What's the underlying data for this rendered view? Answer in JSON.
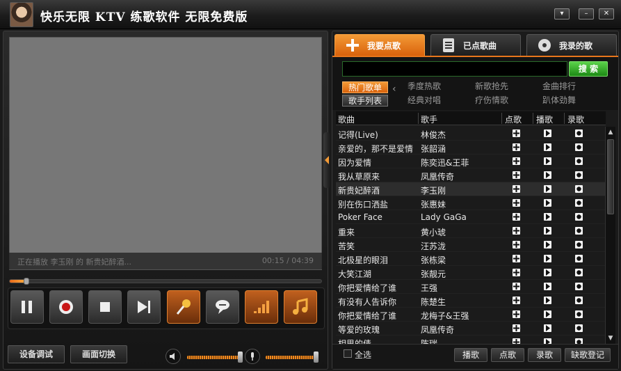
{
  "window": {
    "title": "快乐无限 KTV 练歌软件  无限免费版"
  },
  "player": {
    "now_playing": "正在播放 李玉刚 的 新贵妃醉酒...",
    "time": "00:15 / 04:39",
    "progress": 0.054
  },
  "bottom": {
    "device_btn": "设备调试",
    "screen_btn": "画面切换",
    "music_volume": 0.95,
    "mic_volume": 0.95
  },
  "tabs": [
    {
      "label": "我要点歌",
      "active": true
    },
    {
      "label": "已点歌曲",
      "active": false
    },
    {
      "label": "我录的歌",
      "active": false
    }
  ],
  "search": {
    "value": "",
    "button": "搜 索"
  },
  "categories": {
    "hot": "热门歌单",
    "artists": "歌手列表",
    "links": [
      "季度热歌",
      "新歌抢先",
      "金曲排行",
      "经典对唱",
      "疗伤情歌",
      "趴体劲舞"
    ]
  },
  "table": {
    "headers": [
      "歌曲",
      "歌手",
      "点歌",
      "播歌",
      "录歌"
    ],
    "rows": [
      {
        "song": "记得(Live)",
        "artist": "林俊杰"
      },
      {
        "song": "亲爱的，那不是爱情",
        "artist": "张韶涵"
      },
      {
        "song": "因为爱情",
        "artist": "陈奕迅&王菲"
      },
      {
        "song": "我从草原来",
        "artist": "凤凰传奇"
      },
      {
        "song": "新贵妃醉酒",
        "artist": "李玉刚",
        "highlight": true
      },
      {
        "song": "别在伤口洒盐",
        "artist": "张惠妹"
      },
      {
        "song": "Poker Face",
        "artist": "Lady GaGa"
      },
      {
        "song": "重来",
        "artist": "黄小琥"
      },
      {
        "song": "苦笑",
        "artist": "汪苏泷"
      },
      {
        "song": "北极星的眼泪",
        "artist": "张栋梁"
      },
      {
        "song": "大笑江湖",
        "artist": "张靓元"
      },
      {
        "song": "你把爱情给了谁",
        "artist": "王强"
      },
      {
        "song": "有没有人告诉你",
        "artist": "陈楚生"
      },
      {
        "song": "你把爱情给了谁",
        "artist": "龙梅子&王强"
      },
      {
        "song": "等爱的玫瑰",
        "artist": "凤凰传奇"
      },
      {
        "song": "相思的债",
        "artist": "陈瑞"
      }
    ]
  },
  "footer": {
    "select_all": "全选",
    "buttons": [
      "播歌",
      "点歌",
      "录歌",
      "缺歌登记"
    ]
  },
  "colors": {
    "accent": "#e8761c",
    "search_green": "#2aa01e"
  }
}
